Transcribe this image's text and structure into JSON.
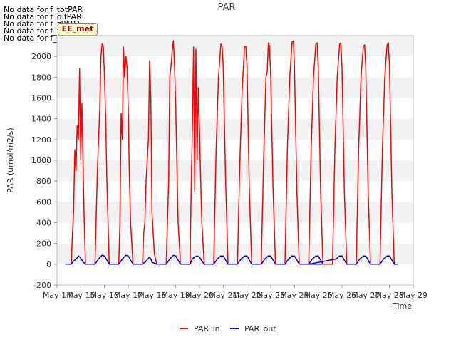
{
  "no_data_messages": [
    "No data for f_totPAR",
    "No data for f_difPAR",
    "No data for f_zPAR1",
    "No data for f_zPAR2",
    "No data for f_zPAR3"
  ],
  "badge_label": "EE_met",
  "colors": {
    "PAR_in": "#ff0000",
    "PAR_out": "#0000cc",
    "band": "#f2f2f2",
    "axis": "#bbbbbb"
  },
  "chart_data": {
    "type": "line",
    "title": "PAR",
    "xlabel": "Time",
    "ylabel": "PAR (umol/m2/s)",
    "ylim": [
      -200,
      2200
    ],
    "yticks": [
      -200,
      0,
      200,
      400,
      600,
      800,
      1000,
      1200,
      1400,
      1600,
      1800,
      2000
    ],
    "xlim": [
      14,
      29
    ],
    "xticks": [
      {
        "value": 14,
        "label": "May 14"
      },
      {
        "value": 15,
        "label": "May 15"
      },
      {
        "value": 16,
        "label": "May 16"
      },
      {
        "value": 17,
        "label": "May 17"
      },
      {
        "value": 18,
        "label": "May 18"
      },
      {
        "value": 19,
        "label": "May 19"
      },
      {
        "value": 20,
        "label": "May 20"
      },
      {
        "value": 21,
        "label": "May 21"
      },
      {
        "value": 22,
        "label": "May 22"
      },
      {
        "value": 23,
        "label": "May 23"
      },
      {
        "value": 24,
        "label": "May 24"
      },
      {
        "value": 25,
        "label": "May 25"
      },
      {
        "value": 26,
        "label": "May 26"
      },
      {
        "value": 27,
        "label": "May 27"
      },
      {
        "value": 28,
        "label": "May 28"
      },
      {
        "value": 29,
        "label": "May 29"
      }
    ],
    "legend_position": "bottom-center",
    "series": [
      {
        "name": "PAR_in",
        "x": [
          14.35,
          14.6,
          14.65,
          14.7,
          14.75,
          14.8,
          14.85,
          14.9,
          14.95,
          15.0,
          15.05,
          15.1,
          15.15,
          15.2,
          15.6,
          15.7,
          15.8,
          15.85,
          15.9,
          15.95,
          16.0,
          16.05,
          16.1,
          16.2,
          16.6,
          16.65,
          16.7,
          16.75,
          16.8,
          16.85,
          16.9,
          16.95,
          17.0,
          17.05,
          17.1,
          17.2,
          17.6,
          17.65,
          17.7,
          17.75,
          17.8,
          17.85,
          17.9,
          17.95,
          18.0,
          18.05,
          18.1,
          18.2,
          18.6,
          18.65,
          18.7,
          18.75,
          18.8,
          18.85,
          18.9,
          18.95,
          19.0,
          19.1,
          19.2,
          19.6,
          19.65,
          19.7,
          19.75,
          19.8,
          19.85,
          19.9,
          19.95,
          20.0,
          20.05,
          20.1,
          20.2,
          20.6,
          20.7,
          20.8,
          20.9,
          20.95,
          21.0,
          21.1,
          21.2,
          21.6,
          21.7,
          21.8,
          21.9,
          21.95,
          22.0,
          22.1,
          22.2,
          22.6,
          22.7,
          22.8,
          22.85,
          22.9,
          22.95,
          23.0,
          23.1,
          23.2,
          23.6,
          23.7,
          23.8,
          23.9,
          23.95,
          24.0,
          24.1,
          24.2,
          24.6,
          24.7,
          24.8,
          24.9,
          24.95,
          25.0,
          25.1,
          25.2,
          25.6,
          25.7,
          25.8,
          25.9,
          25.95,
          26.0,
          26.1,
          26.2,
          26.6,
          26.7,
          26.8,
          26.9,
          26.95,
          27.0,
          27.1,
          27.2,
          27.6,
          27.7,
          27.8,
          27.9,
          27.95,
          28.0,
          28.1,
          28.2,
          28.35
        ],
        "y": [
          0,
          0,
          300,
          500,
          1100,
          900,
          1330,
          1200,
          1880,
          1000,
          1550,
          900,
          400,
          0,
          0,
          900,
          1500,
          2000,
          2120,
          2100,
          1800,
          1400,
          800,
          0,
          0,
          400,
          1450,
          1200,
          2090,
          1800,
          2000,
          1900,
          1500,
          800,
          400,
          0,
          0,
          300,
          400,
          800,
          1000,
          1200,
          1960,
          1600,
          500,
          300,
          100,
          0,
          0,
          400,
          800,
          1800,
          1900,
          2050,
          2150,
          1900,
          1500,
          400,
          0,
          0,
          700,
          1300,
          2090,
          700,
          2070,
          1000,
          1700,
          1300,
          800,
          400,
          0,
          0,
          1100,
          1800,
          2120,
          2100,
          1900,
          800,
          0,
          0,
          1000,
          1700,
          2100,
          2100,
          1900,
          700,
          0,
          0,
          1000,
          1800,
          1850,
          2130,
          2100,
          1800,
          700,
          0,
          0,
          1100,
          1800,
          2140,
          2150,
          1900,
          700,
          0,
          0,
          1100,
          1800,
          2120,
          2130,
          1900,
          700,
          0,
          0,
          1100,
          1800,
          2120,
          2130,
          1900,
          700,
          0,
          0,
          1100,
          1800,
          2100,
          2110,
          1900,
          700,
          0,
          0,
          1100,
          1800,
          2110,
          2130,
          1900,
          700,
          0,
          0
        ]
      },
      {
        "name": "PAR_out",
        "x": [
          14.35,
          14.6,
          14.7,
          14.85,
          14.9,
          15.0,
          15.1,
          15.2,
          15.6,
          15.75,
          15.9,
          16.0,
          16.1,
          16.2,
          16.6,
          16.75,
          16.9,
          17.0,
          17.1,
          17.2,
          17.6,
          17.75,
          17.9,
          17.95,
          18.0,
          18.1,
          18.2,
          18.6,
          18.75,
          18.9,
          19.0,
          19.1,
          19.2,
          19.6,
          19.7,
          19.8,
          19.9,
          20.0,
          20.1,
          20.2,
          20.6,
          20.75,
          20.9,
          21.0,
          21.1,
          21.2,
          21.6,
          21.75,
          21.9,
          22.0,
          22.1,
          22.2,
          22.6,
          22.75,
          22.9,
          23.0,
          23.1,
          23.2,
          23.6,
          23.75,
          23.9,
          24.0,
          24.1,
          24.2,
          24.6,
          24.75,
          24.9,
          25.0,
          25.1,
          25.2,
          24.6,
          25.75,
          25.9,
          26.0,
          26.1,
          26.2,
          26.6,
          26.75,
          26.9,
          27.0,
          27.1,
          27.2,
          27.6,
          27.75,
          27.9,
          28.0,
          28.1,
          28.2,
          28.35
        ],
        "y": [
          0,
          0,
          30,
          60,
          80,
          60,
          20,
          0,
          0,
          50,
          85,
          80,
          40,
          0,
          0,
          50,
          85,
          80,
          40,
          0,
          0,
          30,
          70,
          50,
          20,
          10,
          0,
          0,
          50,
          85,
          80,
          40,
          0,
          0,
          50,
          70,
          80,
          70,
          30,
          0,
          0,
          50,
          80,
          80,
          40,
          0,
          0,
          50,
          80,
          80,
          40,
          0,
          0,
          50,
          80,
          80,
          40,
          0,
          0,
          50,
          80,
          80,
          40,
          0,
          0,
          50,
          80,
          80,
          40,
          0,
          0,
          50,
          80,
          80,
          40,
          0,
          0,
          50,
          80,
          80,
          40,
          0,
          0,
          50,
          80,
          80,
          40,
          0,
          0
        ]
      }
    ]
  }
}
